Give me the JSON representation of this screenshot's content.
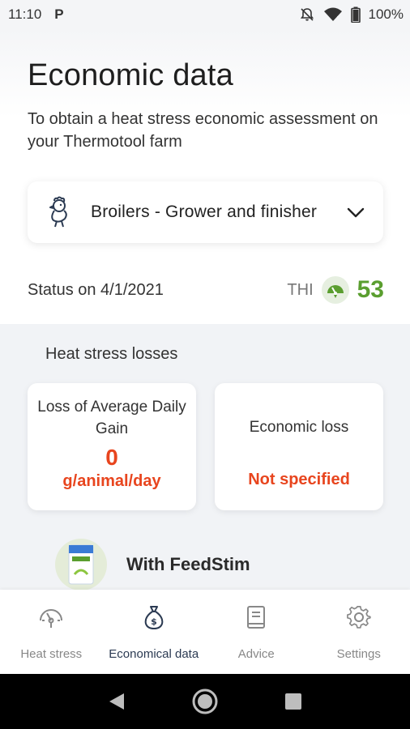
{
  "status_bar": {
    "time": "11:10",
    "app_badge": "P",
    "battery": "100%"
  },
  "page": {
    "title": "Economic data",
    "subtitle": "To obtain a heat stress economic assessment on your Thermotool farm"
  },
  "species_select": {
    "selected": "Broilers - Grower and finisher",
    "icon": "chicken-icon"
  },
  "status": {
    "text": "Status on 4/1/2021",
    "thi_label": "THI",
    "thi_value": "53",
    "thi_color": "#5a9e2f"
  },
  "losses": {
    "title": "Heat stress losses",
    "adg_card": {
      "title": "Loss of Average Daily Gain",
      "value": "0",
      "unit": "g/animal/day"
    },
    "economic_card": {
      "title": "Economic loss",
      "value": "Not specified"
    },
    "accent_color": "#e8451e"
  },
  "feedstim": {
    "label": "With FeedStim"
  },
  "bottom_nav": {
    "items": [
      {
        "label": "Heat stress",
        "icon": "gauge-icon"
      },
      {
        "label": "Economical data",
        "icon": "money-bag-icon",
        "active": true
      },
      {
        "label": "Advice",
        "icon": "book-icon"
      },
      {
        "label": "Settings",
        "icon": "gear-icon"
      }
    ]
  }
}
